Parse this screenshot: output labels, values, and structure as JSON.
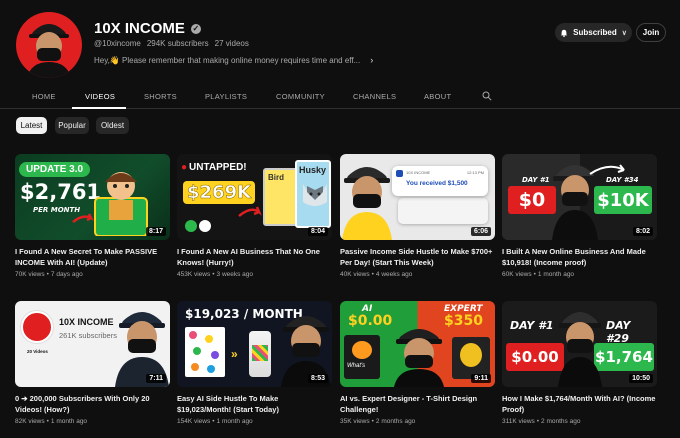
{
  "channel": {
    "name": "10X INCOME",
    "handle": "@10xincome",
    "subscribers": "294K subscribers",
    "videos_count": "27 videos",
    "description": "Hey,👋 Please remember that making online money requires time and eff...",
    "more_glyph": "›",
    "verified_glyph": "✓"
  },
  "actions": {
    "subscribed_label": "Subscribed",
    "join_label": "Join",
    "chevron": "∨"
  },
  "tabs": [
    {
      "label": "HOME"
    },
    {
      "label": "VIDEOS"
    },
    {
      "label": "SHORTS"
    },
    {
      "label": "PLAYLISTS"
    },
    {
      "label": "COMMUNITY"
    },
    {
      "label": "CHANNELS"
    },
    {
      "label": "ABOUT"
    }
  ],
  "filters": [
    {
      "label": "Latest"
    },
    {
      "label": "Popular"
    },
    {
      "label": "Oldest"
    }
  ],
  "videos": [
    {
      "title": "I Found A New Secret To Make PASSIVE INCOME With AI! (Update)",
      "views": "70K views",
      "sep": "•",
      "age": "7 days ago",
      "duration": "8:17",
      "thumb": {
        "badge": "UPDATE 3.0",
        "amount": "$2,761",
        "sub": "PER MONTH"
      }
    },
    {
      "title": "I Found A New AI Business That No One Knows! (Hurry!)",
      "views": "453K views",
      "sep": "•",
      "age": "3 weeks ago",
      "duration": "8:04",
      "thumb": {
        "badge": "UNTAPPED!",
        "amount": "$269K",
        "book1": "Bird",
        "book2": "Husky"
      }
    },
    {
      "title": "Passive Income Side Hustle to Make $700+ Per Day! (Start This Week)",
      "views": "40K views",
      "sep": "•",
      "age": "4 weeks ago",
      "duration": "6:06",
      "thumb": {
        "notif_app": "10X INCOME",
        "notif_time": "12:13 PM",
        "notif_text": "You received $1,500"
      }
    },
    {
      "title": "I Built A New Online Business And Made $10,918! (Income proof)",
      "views": "60K views",
      "sep": "•",
      "age": "1 month ago",
      "duration": "8:02",
      "thumb": {
        "day1": "DAY #1",
        "day2": "DAY #34",
        "left": "$0",
        "right": "$10K"
      }
    },
    {
      "title": "0 ➔ 200,000 Subscribers With Only 20 Videos! (How?)",
      "views": "82K views",
      "sep": "•",
      "age": "1 month ago",
      "duration": "7:11",
      "thumb": {
        "name": "10X INCOME",
        "subs": "261K subscribers",
        "videos": "20 Videos"
      }
    },
    {
      "title": "Easy AI Side Hustle To Make $19,023/Month! (Start Today)",
      "views": "154K views",
      "sep": "•",
      "age": "1 month ago",
      "duration": "8:53",
      "thumb": {
        "banner": "$19,023 / MONTH"
      }
    },
    {
      "title": "AI vs. Expert Designer - T-Shirt Design Challenge!",
      "views": "35K views",
      "sep": "•",
      "age": "2 months ago",
      "duration": "9:11",
      "thumb": {
        "left_label": "AI",
        "left_amount": "$0.00",
        "right_label": "EXPERT",
        "right_amount": "$350",
        "shirt_text": "What's"
      }
    },
    {
      "title": "How I Make $1,764/Month With AI? (Income Proof)",
      "views": "311K views",
      "sep": "•",
      "age": "2 months ago",
      "duration": "10:50",
      "thumb": {
        "day1": "DAY #1",
        "day2": "DAY #29",
        "left": "$0.00",
        "right": "$1,764"
      }
    }
  ],
  "colors": {
    "background": "#0f0f0f",
    "accent_green": "#2db84d",
    "accent_red": "#e02020",
    "accent_yellow": "#ffd21f"
  }
}
